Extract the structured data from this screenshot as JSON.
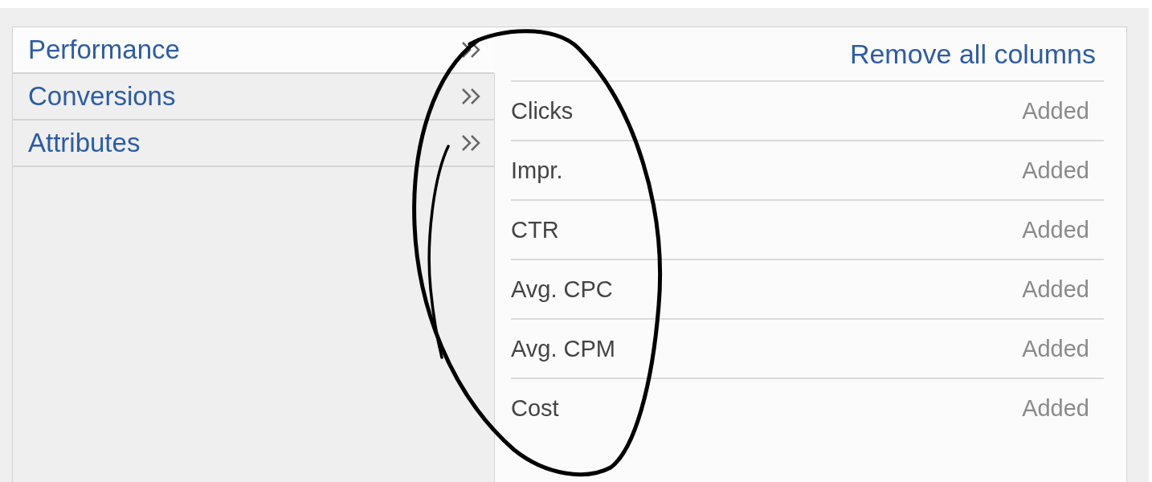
{
  "categories": [
    {
      "label": "Performance",
      "selected": true
    },
    {
      "label": "Conversions",
      "selected": false
    },
    {
      "label": "Attributes",
      "selected": false
    }
  ],
  "remove_all": "Remove all columns",
  "columns": [
    {
      "name": "Clicks",
      "status": "Added"
    },
    {
      "name": "Impr.",
      "status": "Added"
    },
    {
      "name": "CTR",
      "status": "Added"
    },
    {
      "name": "Avg. CPC",
      "status": "Added"
    },
    {
      "name": "Avg. CPM",
      "status": "Added"
    },
    {
      "name": "Cost",
      "status": "Added"
    }
  ]
}
